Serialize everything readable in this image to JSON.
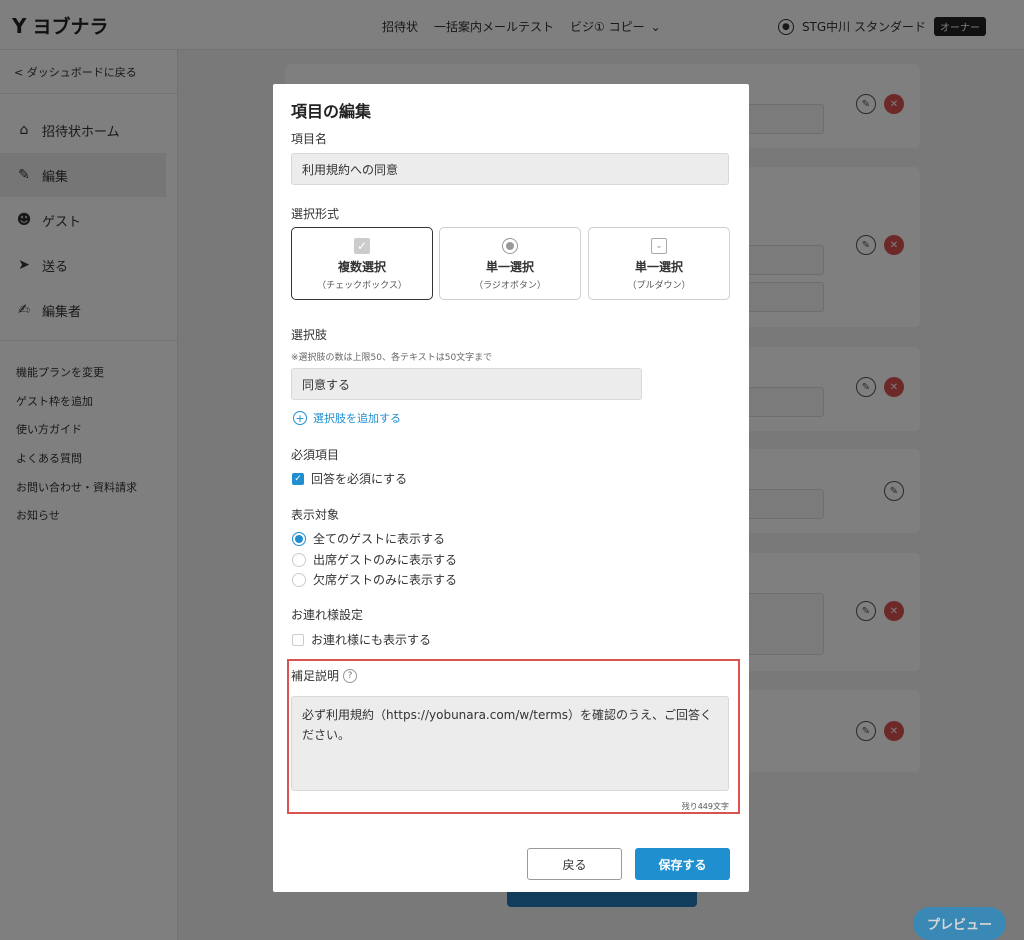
{
  "header": {
    "logo_text": "ヨブナラ",
    "nav": [
      "招待状",
      "一括案内メールテスト",
      "ビジ① コピー"
    ],
    "user_name": "STG中川 スタンダード",
    "role_badge": "オーナー"
  },
  "sidebar": {
    "back_label": "< ダッシュボードに戻る",
    "items": [
      {
        "label": "招待状ホーム",
        "icon": "home-icon"
      },
      {
        "label": "編集",
        "icon": "pencil-icon"
      },
      {
        "label": "ゲスト",
        "icon": "people-icon"
      },
      {
        "label": "送る",
        "icon": "send-icon"
      },
      {
        "label": "編集者",
        "icon": "editor-icon"
      }
    ],
    "links": [
      "機能プランを変更",
      "ゲスト枠を追加",
      "使い方ガイド",
      "よくある質問",
      "お問い合わせ・資料請求",
      "お知らせ"
    ]
  },
  "preview_label": "プレビュー",
  "modal": {
    "title": "項目の編集",
    "item_name_label": "項目名",
    "item_name_value": "利用規約への同意",
    "format_label": "選択形式",
    "formats": [
      {
        "name": "複数選択",
        "sub": "（チェックボックス）"
      },
      {
        "name": "単一選択",
        "sub": "（ラジオボタン）"
      },
      {
        "name": "単一選択",
        "sub": "（プルダウン）"
      }
    ],
    "options_label": "選択肢",
    "options_note": "※選択肢の数は上限50、各テキストは50文字まで",
    "option_value": "同意する",
    "add_option_label": "選択肢を追加する",
    "required_label": "必須項目",
    "required_check": "回答を必須にする",
    "display_label": "表示対象",
    "display_options": [
      "全てのゲストに表示する",
      "出席ゲストのみに表示する",
      "欠席ゲストのみに表示する"
    ],
    "companion_label": "お連れ様設定",
    "companion_check": "お連れ様にも表示する",
    "supplement_label": "補足説明",
    "help_mark": "?",
    "supplement_value": "必ず利用規約（https://yobunara.com/w/terms）を確認のうえ、ご回答ください。",
    "remaining": "残り449文字",
    "back_button": "戻る",
    "save_button": "保存する"
  }
}
